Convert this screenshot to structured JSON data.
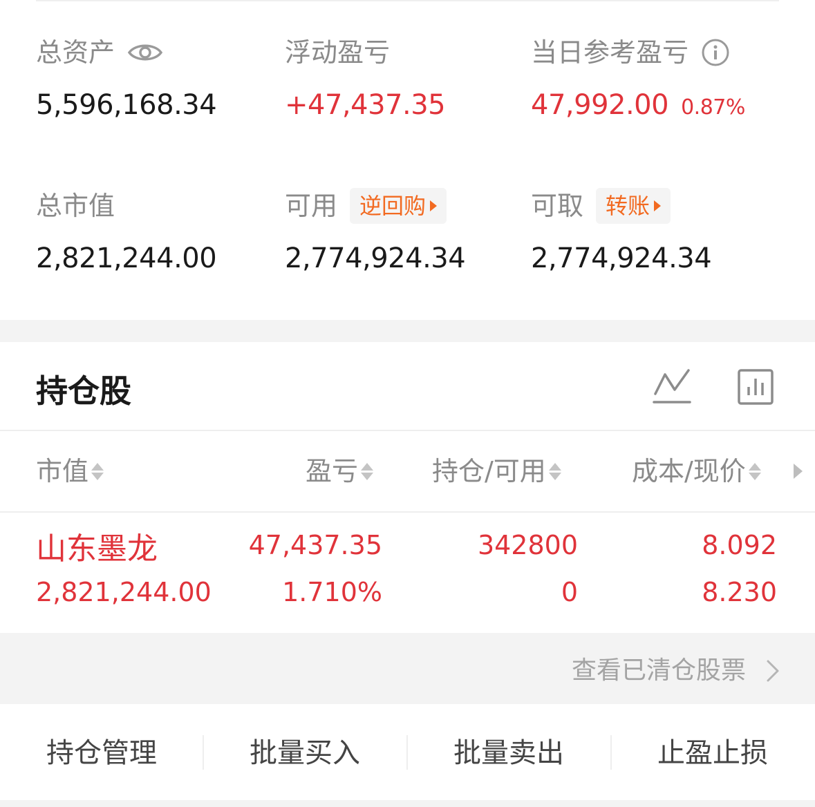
{
  "summary": {
    "total_assets": {
      "label": "总资产",
      "value": "5,596,168.34",
      "icon": "eye-icon"
    },
    "floating_pl": {
      "label": "浮动盈亏",
      "value": "+47,437.35"
    },
    "daily_pl": {
      "label": "当日参考盈亏",
      "value": "47,992.00",
      "percent": "0.87%",
      "icon": "info-icon"
    },
    "market_value": {
      "label": "总市值",
      "value": "2,821,244.00"
    },
    "available": {
      "label": "可用",
      "tag": "逆回购",
      "value": "2,774,924.34"
    },
    "withdrawable": {
      "label": "可取",
      "tag": "转账",
      "value": "2,774,924.34"
    }
  },
  "holdings": {
    "title": "持仓股",
    "icons": [
      "trend-line-icon",
      "bar-chart-icon"
    ],
    "columns": [
      "市值",
      "盈亏",
      "持仓/可用",
      "成本/现价"
    ],
    "rows": [
      {
        "name": "山东墨龙",
        "market_value": "2,821,244.00",
        "pl": "47,437.35",
        "pl_pct": "1.710%",
        "position": "342800",
        "available": "0",
        "cost": "8.092",
        "price": "8.230"
      }
    ],
    "cleared_link": "查看已清仓股票"
  },
  "actions": [
    "持仓管理",
    "批量买入",
    "批量卖出",
    "止盈止损"
  ],
  "colors": {
    "red": "#e0333a",
    "orange": "#f26a21",
    "gray_text": "#8a8a8a"
  }
}
